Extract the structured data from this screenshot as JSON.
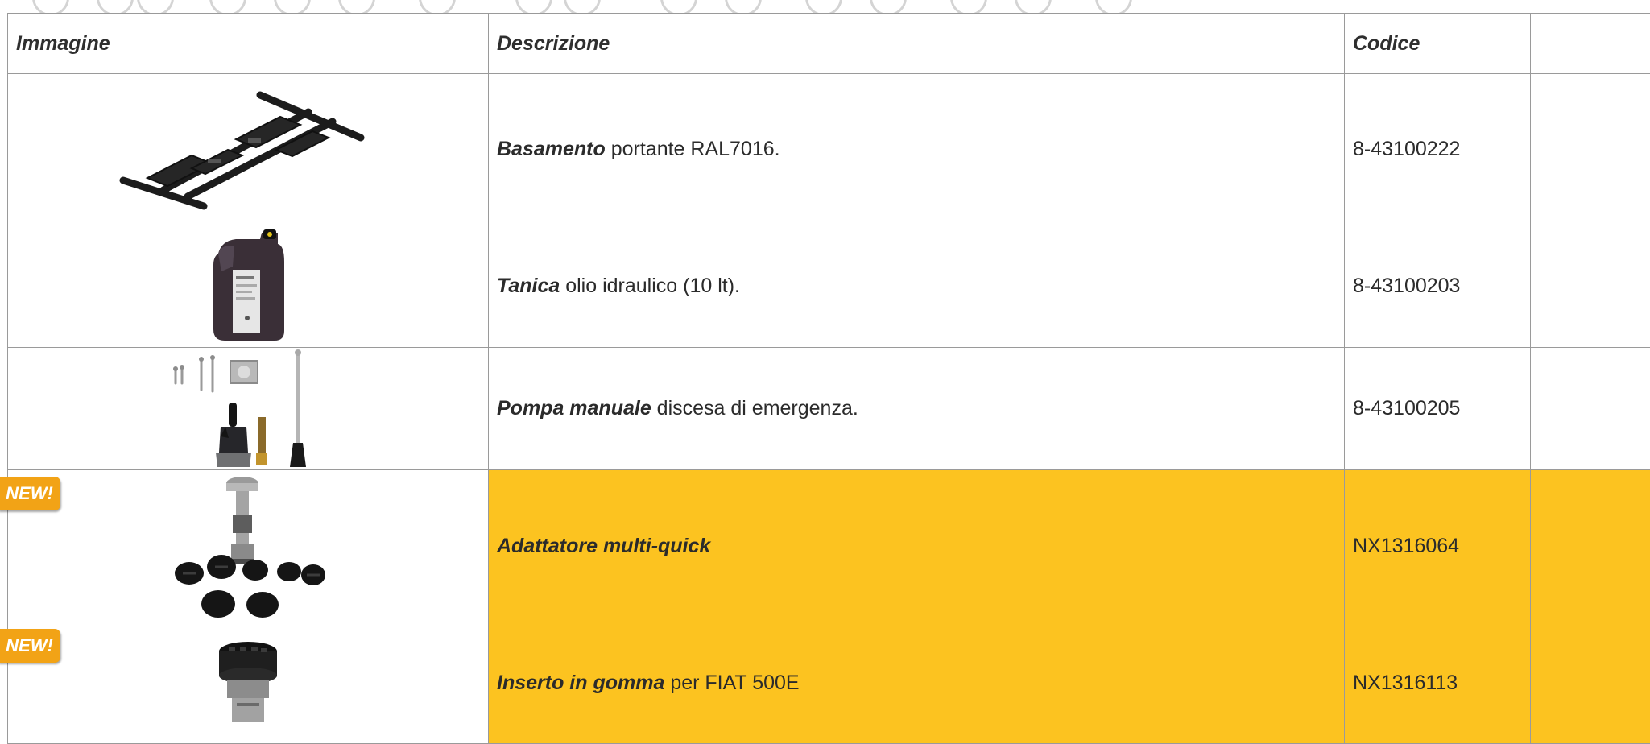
{
  "table": {
    "headers": {
      "image": "Immagine",
      "description": "Descrizione",
      "code": "Codice",
      "extra": ""
    },
    "rows": [
      {
        "label": "Basamento",
        "text": " portante RAL7016.",
        "code": "8-43100222",
        "is_new": false,
        "image": "black-steel-base-frame"
      },
      {
        "label": "Tanica",
        "text": " olio idraulico (10 lt).",
        "code": "8-43100203",
        "is_new": false,
        "image": "hydraulic-oil-canister"
      },
      {
        "label": "Pompa manuale",
        "text": " discesa di emergenza.",
        "code": "8-43100205",
        "is_new": false,
        "image": "emergency-hand-pump-kit"
      },
      {
        "label": "Adattatore multi-quick",
        "text": "",
        "code": "NX1316064",
        "is_new": true,
        "badge": "NEW!",
        "image": "multi-quick-adapter-set"
      },
      {
        "label": "Inserto in gomma",
        "text": " per FIAT 500E",
        "code": "NX1316113",
        "is_new": true,
        "badge": "NEW!",
        "image": "rubber-pad-insert"
      }
    ]
  },
  "colors": {
    "highlight": "#fcc320",
    "badge": "#f2a316",
    "border": "#9a9a9a"
  }
}
